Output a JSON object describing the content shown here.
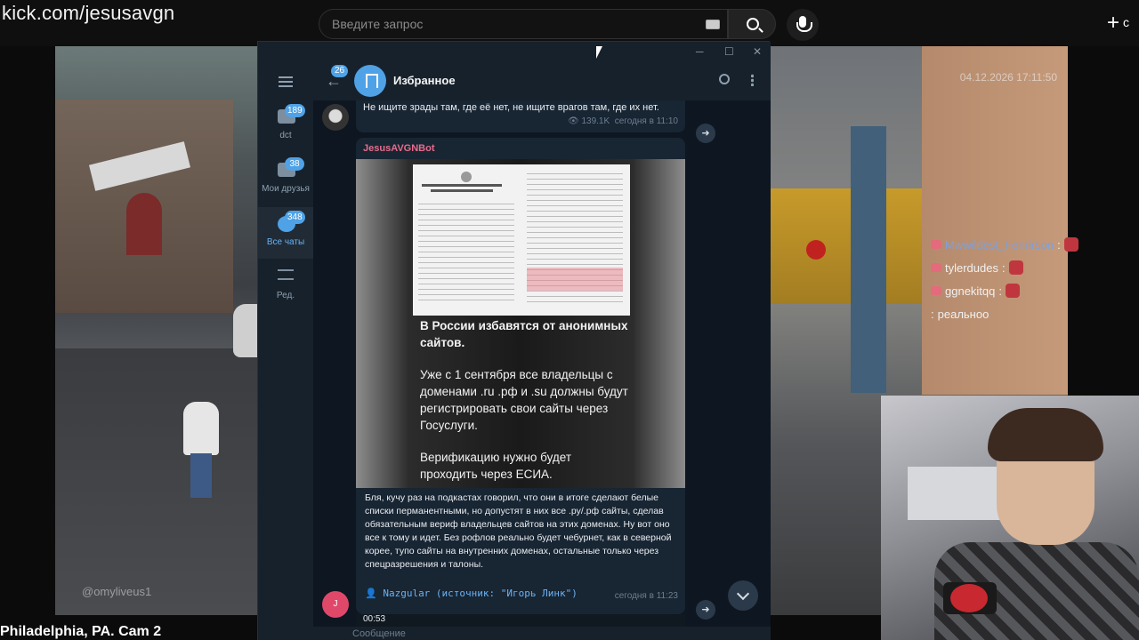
{
  "browser": {
    "url": "kick.com/jesusavgn",
    "search_placeholder": "Введите запрос",
    "create_label": "с"
  },
  "stream": {
    "camera_watermark": "@omyliveus1",
    "camera_timestamp": "04.12.2026 17:11:50",
    "title": "Philadelphia, PA. Cam 2",
    "chat": [
      {
        "user": "Mwwildest_Fenrirson",
        "text": ""
      },
      {
        "user": "tylerdudes",
        "text": ""
      },
      {
        "user": "ggnekitqq",
        "text": ""
      },
      {
        "user": "",
        "text": "реальноо"
      }
    ]
  },
  "telegram": {
    "sidebar": {
      "folders": [
        {
          "label": "dct",
          "count": "189"
        },
        {
          "label": "Мои друзья",
          "count": "38"
        },
        {
          "label": "Все чаты",
          "count": "348"
        },
        {
          "label": "Ред.",
          "count": ""
        }
      ]
    },
    "header": {
      "back_count": "26",
      "title": "Избранное"
    },
    "messages": [
      {
        "text": "Не ищите зрады там, где её нет, не ищите врагов там, где их нет.",
        "views": "139.1K",
        "time": "сегодня в 11:10"
      },
      {
        "bot": "JesusAVGNBot",
        "photo_headline": "В России избавятся от анонимных сайтов.",
        "photo_body": "Уже с 1 сентября все владельцы с доменами .ru .рф и .su должны будут регистрировать свои сайты через Госуслуги.",
        "photo_footer": "Верификацию нужно будет проходить через ЕСИА.",
        "caption": "Бля, кучу раз на подкастах говорил, что они в итоге сделают белые списки перманентными, но допустят в них все .ру/.рф сайты, сделав обязательным вериф владельцев сайтов на этих доменах. Ну вот оно все к тому и идет. Без рофлов реально будет чебурнет, как в северной корее, тупо сайты на внутренних доменах, остальные только через спецразрешения и талоны.",
        "source": "Nazgular (источник: \"Игорь Линк\")",
        "time": "сегодня в 11:23"
      }
    ],
    "player_time": "00:53",
    "composer_placeholder": "Сообщение"
  }
}
